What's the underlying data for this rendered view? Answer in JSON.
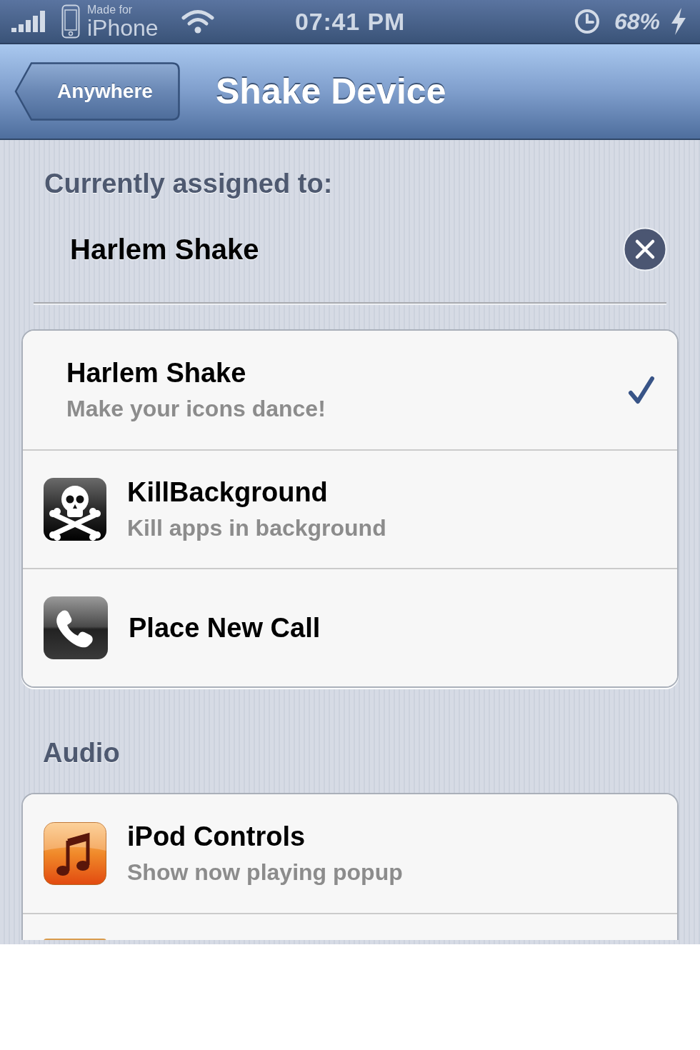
{
  "status_bar": {
    "made_for": "Made for",
    "device": "iPhone",
    "time": "07:41 PM",
    "battery": "68%"
  },
  "nav_bar": {
    "back_button": "Anywhere",
    "title": "Shake Device"
  },
  "assignment": {
    "label": "Currently assigned to:",
    "value": "Harlem Shake"
  },
  "sections": [
    {
      "rows": [
        {
          "kind": "text",
          "title": "Harlem Shake",
          "subtitle": "Make your icons dance!",
          "selected": true
        },
        {
          "kind": "skull",
          "title": "KillBackground",
          "subtitle": "Kill apps in background",
          "selected": false
        },
        {
          "kind": "phone",
          "title": "Place New Call",
          "selected": false
        }
      ]
    },
    {
      "header": "Audio",
      "rows": [
        {
          "kind": "music",
          "title": "iPod Controls",
          "subtitle": "Show now playing popup",
          "selected": false
        }
      ],
      "more_rows_below": true
    }
  ]
}
